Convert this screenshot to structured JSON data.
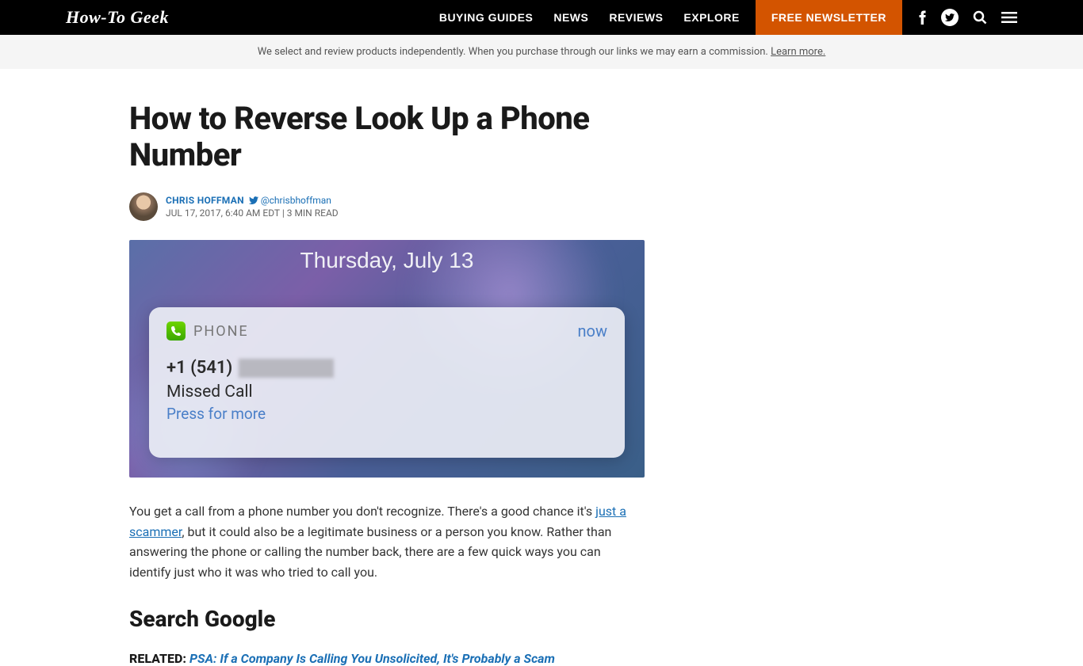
{
  "header": {
    "logo": "How-To Geek",
    "nav": [
      "BUYING GUIDES",
      "NEWS",
      "REVIEWS",
      "EXPLORE"
    ],
    "newsletter": "FREE NEWSLETTER"
  },
  "disclaimer": {
    "text": "We select and review products independently. When you purchase through our links we may earn a commission. ",
    "link": "Learn more."
  },
  "article": {
    "title": "How to Reverse Look Up a Phone Number",
    "author": "CHRIS HOFFMAN",
    "twitter_handle": "@chrisbhoffman",
    "date": "JUL 17, 2017, 6:40 AM EDT | 3 MIN READ",
    "hero": {
      "date": "Thursday, July 13",
      "app_label": "PHONE",
      "now": "now",
      "number_prefix": "+1 (541)",
      "status": "Missed Call",
      "press": "Press for more"
    },
    "intro_1": "You get a call from a phone number you don't recognize. There's a good chance it's ",
    "intro_link": "just a scammer",
    "intro_2": ", but it could also be a legitimate business or a person you know. Rather than answering the phone or calling the number back, there are a few quick ways you can identify just who it was who tried to call you.",
    "section1_title": "Search Google",
    "related_label": "RELATED: ",
    "related_link": "PSA: If a Company Is Calling You Unsolicited, It's Probably a Scam"
  }
}
